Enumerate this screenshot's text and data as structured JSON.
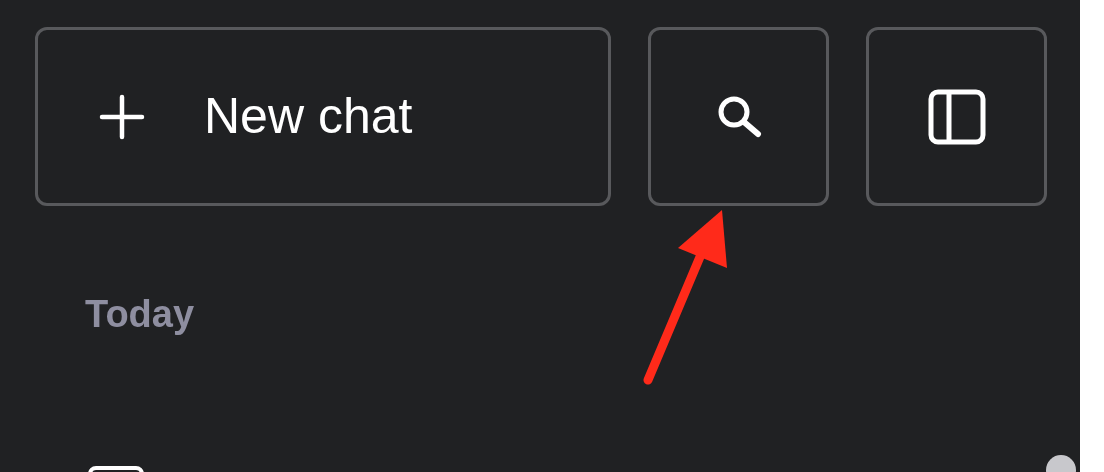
{
  "new_chat_button": {
    "label": "New chat"
  },
  "section": {
    "title": "Today"
  }
}
